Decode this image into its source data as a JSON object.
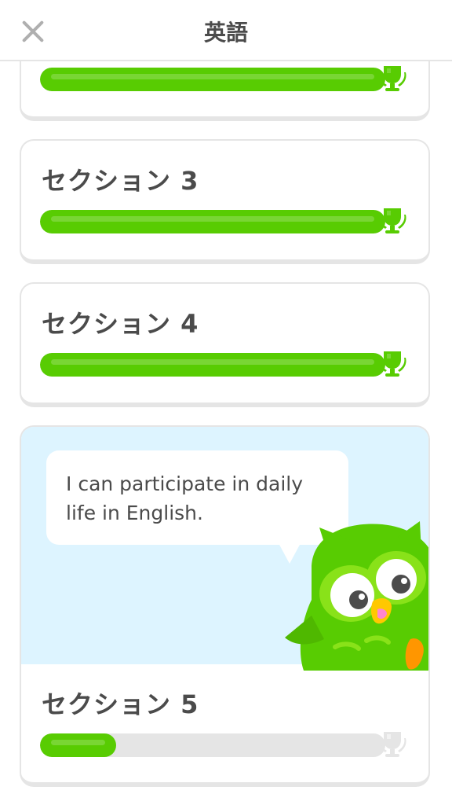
{
  "header": {
    "title": "英語",
    "close_icon": "close-icon"
  },
  "sections": [
    {
      "title": "",
      "progress_percent": 100,
      "completed": true
    },
    {
      "title": "セクション 3",
      "progress_percent": 100,
      "completed": true
    },
    {
      "title": "セクション 4",
      "progress_percent": 100,
      "completed": true
    },
    {
      "title": "セクション 5",
      "progress_percent": 22,
      "completed": false,
      "promo_text": "I can participate in daily life in English."
    }
  ],
  "colors": {
    "accent_green": "#58cc02",
    "track_gray": "#e5e5e5",
    "promo_bg": "#ddf4ff",
    "trophy_inactive": "#d9d9d9"
  },
  "icons": {
    "trophy": "trophy-icon",
    "mascot": "owl-mascot"
  }
}
